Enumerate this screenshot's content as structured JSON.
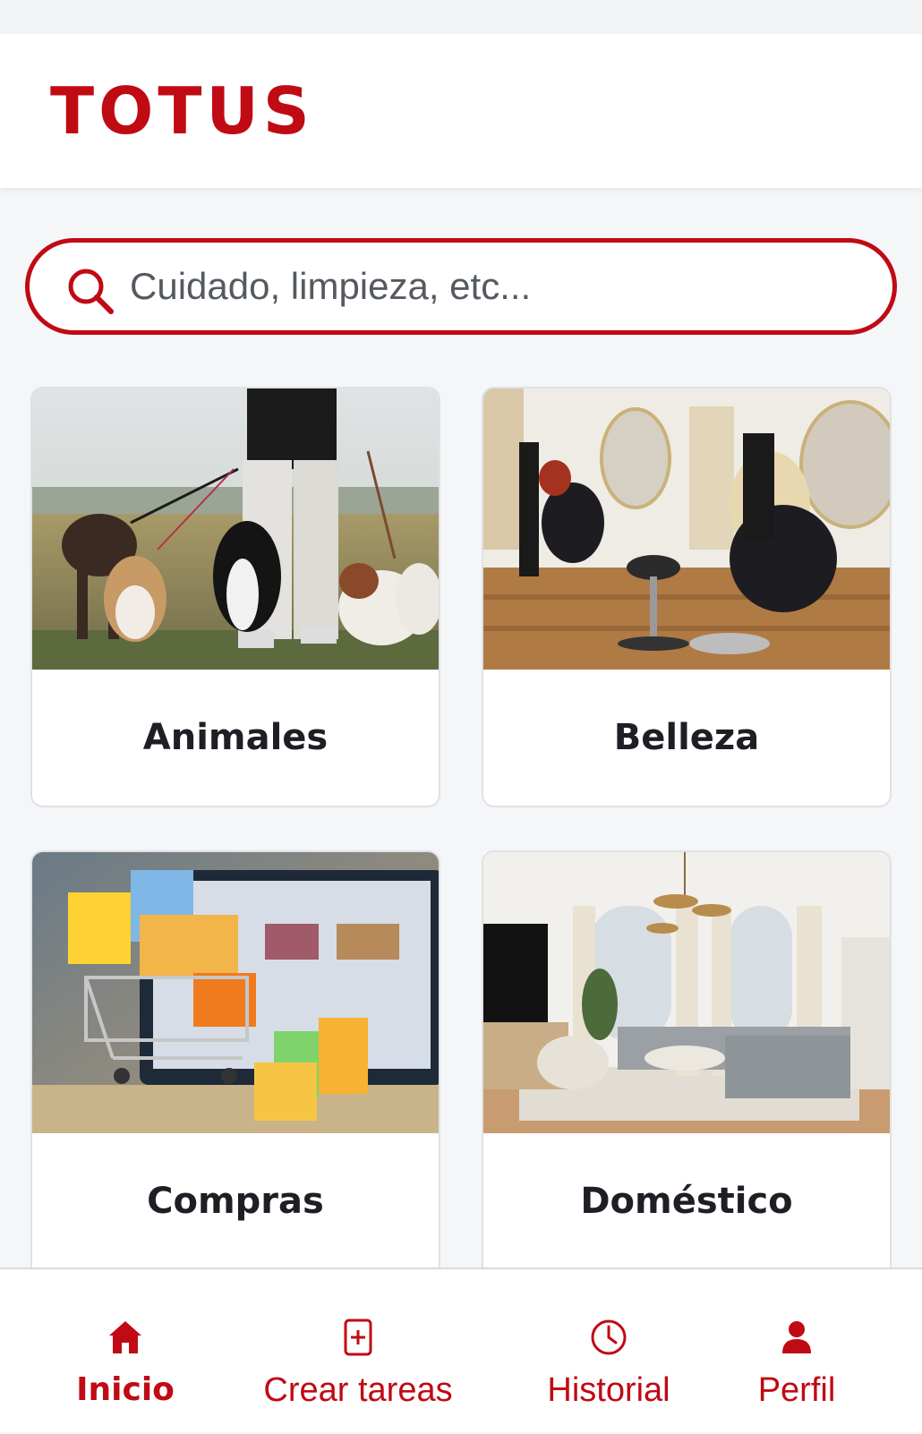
{
  "header": {
    "brand": "TOTUS"
  },
  "search": {
    "placeholder": "Cuidado, limpieza, etc..."
  },
  "categories": [
    {
      "label": "Animales",
      "image": "dogs-walking-photo"
    },
    {
      "label": "Belleza",
      "image": "hair-salon-photo"
    },
    {
      "label": "Compras",
      "image": "shopping-cart-laptop-photo"
    },
    {
      "label": "Doméstico",
      "image": "living-room-photo"
    }
  ],
  "nav": {
    "active": "Inicio",
    "items": [
      {
        "label": "Inicio",
        "icon": "home-icon"
      },
      {
        "label": "Crear tareas",
        "icon": "add-task-icon"
      },
      {
        "label": "Historial",
        "icon": "clock-icon"
      },
      {
        "label": "Perfil",
        "icon": "user-icon"
      }
    ]
  },
  "colors": {
    "brand": "#c00a14",
    "background": "#f5f6f8",
    "text": "#1e1e24"
  }
}
